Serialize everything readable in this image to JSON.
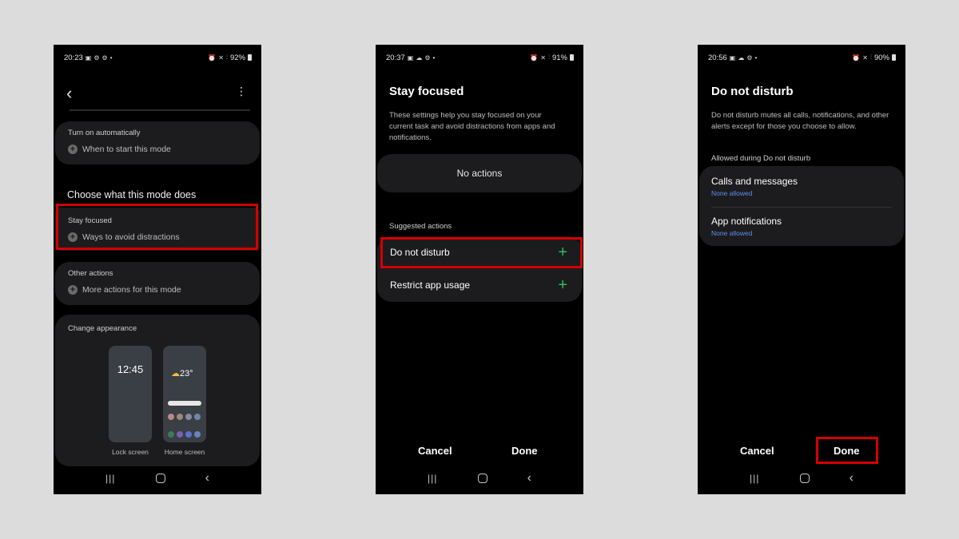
{
  "phone1": {
    "status": {
      "time": "20:23",
      "battery": "92%"
    },
    "back_icon": "‹",
    "more_icon": "⋮",
    "turn_on_section": {
      "label": "Turn on automatically",
      "item": "When to start this mode"
    },
    "choose_heading": "Choose what this mode does",
    "stay_focused_section": {
      "label": "Stay focused",
      "item": "Ways to avoid distractions"
    },
    "other_actions_section": {
      "label": "Other actions",
      "item": "More actions for this mode"
    },
    "appearance": {
      "label": "Change appearance",
      "lock_time": "12:45",
      "home_temp": "23°",
      "lock_label": "Lock screen",
      "home_label": "Home screen"
    }
  },
  "phone2": {
    "status": {
      "time": "20:37",
      "battery": "91%"
    },
    "title": "Stay focused",
    "description": "These settings help you stay focused on your current task and avoid distractions from apps and notifications.",
    "no_actions": "No actions",
    "suggested_label": "Suggested actions",
    "actions": [
      {
        "label": "Do not disturb"
      },
      {
        "label": "Restrict app usage"
      }
    ],
    "cancel": "Cancel",
    "done": "Done"
  },
  "phone3": {
    "status": {
      "time": "20:56",
      "battery": "90%"
    },
    "title": "Do not disturb",
    "description": "Do not disturb mutes all calls, notifications, and other alerts except for those you choose to allow.",
    "allowed_label": "Allowed during Do not disturb",
    "items": [
      {
        "label": "Calls and messages",
        "sub": "None allowed"
      },
      {
        "label": "App notifications",
        "sub": "None allowed"
      }
    ],
    "cancel": "Cancel",
    "done": "Done"
  },
  "colors": {
    "highlight": "#d40000",
    "accent_green": "#2fbf57",
    "link_blue": "#5b8ef0"
  }
}
